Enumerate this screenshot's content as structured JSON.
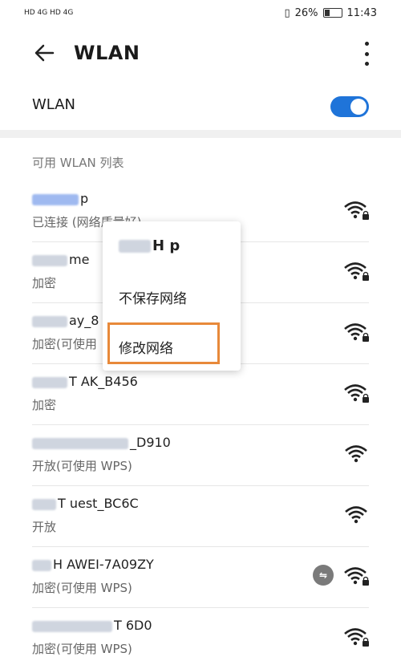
{
  "status": {
    "left": "HD 4G HD 4G",
    "battery": "26%",
    "time": "11:43"
  },
  "header": {
    "title": "WLAN"
  },
  "wlan_toggle": {
    "label": "WLAN",
    "state": "on"
  },
  "section_title": "可用 WLAN 列表",
  "networks": [
    {
      "name_visible": "p",
      "status": "已连接 (网络质量好)"
    },
    {
      "name_visible": "me",
      "status": "加密"
    },
    {
      "name_visible": "ay_8",
      "status": "加密(可使用"
    },
    {
      "name_visible": "T AK_B456",
      "status": "加密"
    },
    {
      "name_visible": "_D910",
      "status": "开放(可使用 WPS)"
    },
    {
      "name_visible": "T uest_BC6C",
      "status": "开放"
    },
    {
      "name_visible": "H AWEI-7A09ZY",
      "status": "加密(可使用 WPS)"
    },
    {
      "name_visible": "T 6D0",
      "status": "加密(可使用 WPS)"
    }
  ],
  "menu": {
    "title": "H p",
    "items": [
      "不保存网络",
      "修改网络"
    ]
  },
  "colors": {
    "accent": "#1f74d9",
    "highlight": "#e8893a"
  }
}
